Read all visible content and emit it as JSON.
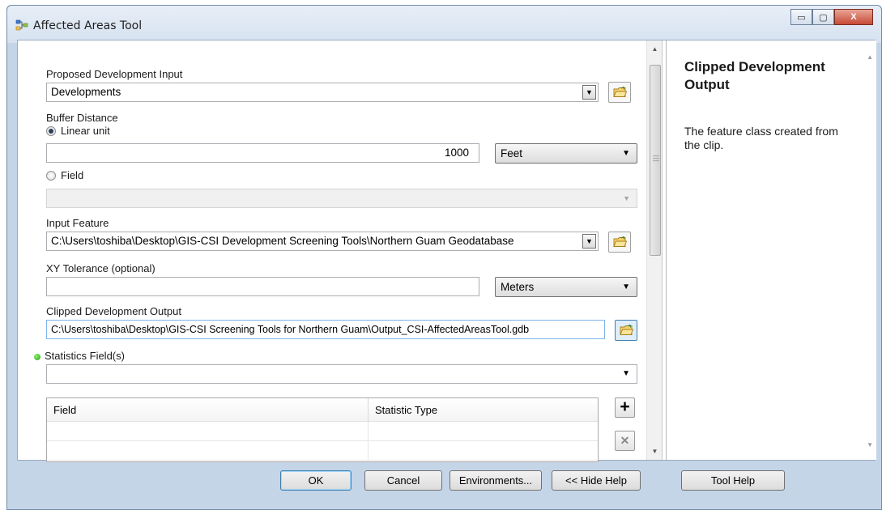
{
  "window": {
    "title": "Affected Areas Tool",
    "controls": {
      "minimize": "▭",
      "maximize": "▢",
      "close": "X"
    }
  },
  "form": {
    "proposed_development_input": {
      "label": "Proposed Development Input",
      "value": "Developments"
    },
    "buffer_distance": {
      "label": "Buffer Distance",
      "linear_unit_label": "Linear unit",
      "linear_unit_selected": true,
      "distance_value": "1000",
      "unit_value": "Feet",
      "field_label": "Field",
      "field_selected": false,
      "field_value": ""
    },
    "input_feature": {
      "label": "Input Feature",
      "value": "C:\\Users\\toshiba\\Desktop\\GIS-CSI Development Screening Tools\\Northern Guam Geodatabase"
    },
    "xy_tolerance": {
      "label": "XY Tolerance (optional)",
      "value": "",
      "unit_value": "Meters"
    },
    "clipped_development_output": {
      "label": "Clipped Development Output",
      "value": "C:\\Users\\toshiba\\Desktop\\GIS-CSI Screening Tools for Northern Guam\\Output_CSI-AffectedAreasTool.gdb"
    },
    "statistics_fields": {
      "label": "Statistics Field(s)",
      "value": "",
      "columns": [
        "Field",
        "Statistic Type"
      ],
      "add_symbol": "+",
      "remove_symbol": "✕"
    }
  },
  "help": {
    "title": "Clipped Development Output",
    "body": "The feature class created from the clip."
  },
  "buttons": {
    "ok": "OK",
    "cancel": "Cancel",
    "environments": "Environments...",
    "hide_help": "<< Hide Help",
    "tool_help": "Tool Help"
  },
  "colors": {
    "title_bar": "#d6e2f0",
    "close_button": "#c74a36",
    "required_indicator": "#2aa01a",
    "focus_border": "#3c7fb1"
  }
}
